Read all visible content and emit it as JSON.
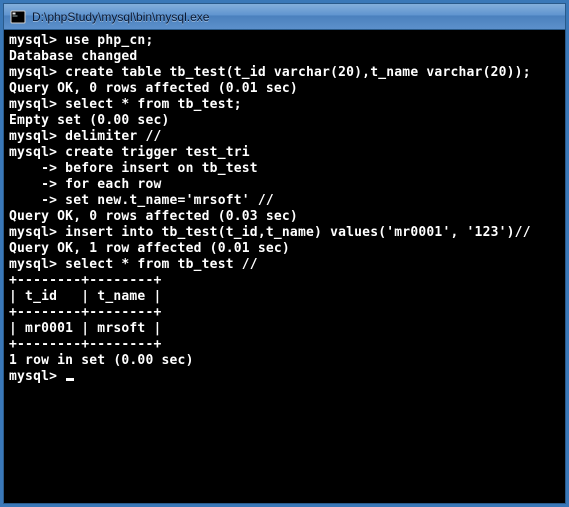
{
  "window": {
    "title": "D:\\phpStudy\\mysql\\bin\\mysql.exe",
    "icon_name": "mysql-console-icon"
  },
  "terminal": {
    "lines": [
      "",
      "mysql> use php_cn;",
      "Database changed",
      "mysql> create table tb_test(t_id varchar(20),t_name varchar(20));",
      "Query OK, 0 rows affected (0.01 sec)",
      "",
      "mysql> select * from tb_test;",
      "Empty set (0.00 sec)",
      "",
      "mysql> delimiter //",
      "mysql> create trigger test_tri",
      "    -> before insert on tb_test",
      "    -> for each row",
      "    -> set new.t_name='mrsoft' //",
      "Query OK, 0 rows affected (0.03 sec)",
      "",
      "mysql> insert into tb_test(t_id,t_name) values('mr0001', '123')//",
      "Query OK, 1 row affected (0.01 sec)",
      "",
      "mysql> select * from tb_test //",
      "+--------+--------+",
      "| t_id   | t_name |",
      "+--------+--------+",
      "| mr0001 | mrsoft |",
      "+--------+--------+",
      "1 row in set (0.00 sec)",
      "",
      "mysql> "
    ]
  }
}
